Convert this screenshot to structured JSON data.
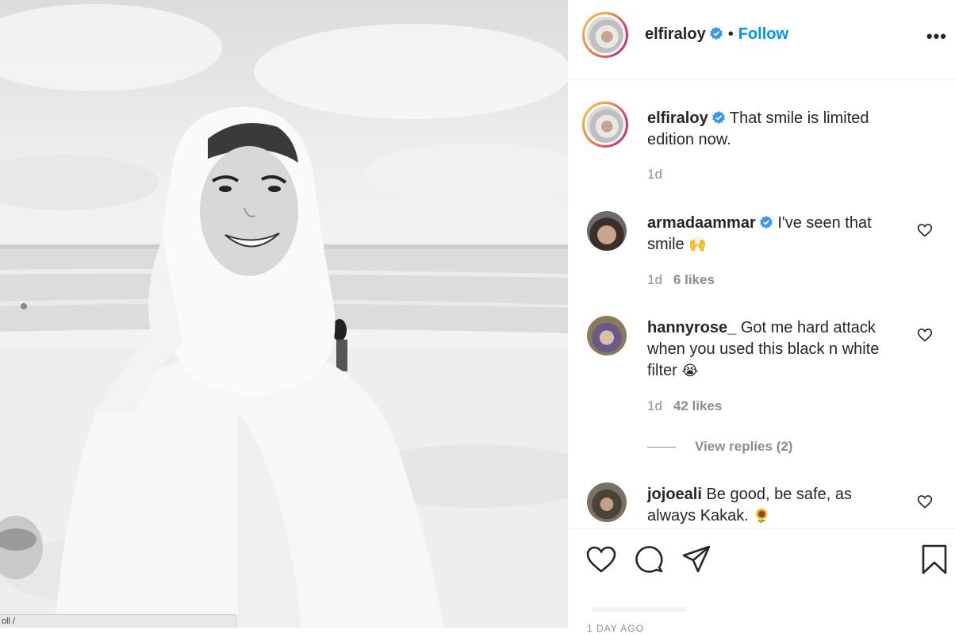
{
  "post": {
    "status_text": "oll /"
  },
  "header": {
    "username": "elfiraloy",
    "separator": "•",
    "follow_label": "Follow",
    "more_label": "•••"
  },
  "caption": {
    "username": "elfiraloy",
    "text": "That smile is limited edition now.",
    "time": "1d"
  },
  "comments": [
    {
      "username": "armadaammar",
      "verified": true,
      "text": "I've seen that smile",
      "emoji": "🙌",
      "time": "1d",
      "likes": "6 likes"
    },
    {
      "username": "hannyrose_",
      "verified": false,
      "text": "Got me hard attack when you used this black n white filter",
      "emoji": "😭",
      "time": "1d",
      "likes": "42 likes",
      "view_replies": "View replies (2)"
    },
    {
      "username": "jojoeali",
      "verified": false,
      "text": "Be good, be safe, as always Kakak.",
      "emoji": "🌻"
    }
  ],
  "footer": {
    "timestamp": "1 DAY AGO"
  },
  "colors": {
    "link_blue": "#0095f6",
    "verified_blue": "#3897f0",
    "text": "#262626",
    "muted": "#8e8e8e"
  },
  "icons": [
    "heart-icon",
    "comment-icon",
    "share-icon",
    "bookmark-icon",
    "verified-badge-icon",
    "more-options-icon"
  ]
}
